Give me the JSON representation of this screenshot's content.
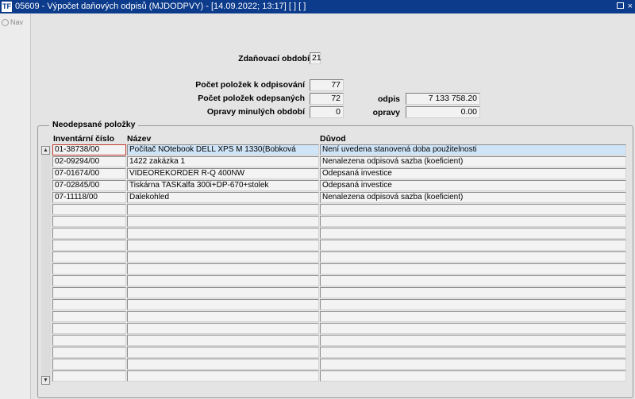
{
  "window": {
    "title": "05609 - Výpočet daňových odpisů (MJDODPVY) - [14.09.2022; 13:17] [ ] [ ]",
    "app_icon": "TF",
    "restore_glyph": "",
    "close_glyph": "×"
  },
  "nav": {
    "label": "Nav"
  },
  "form": {
    "period_label": "Zdaňovací období",
    "period_value": "21",
    "items_to_depreciate_label": "Počet položek k odpisování",
    "items_to_depreciate_value": "77",
    "items_depreciated_label": "Počet položek odepsaných",
    "items_depreciated_value": "72",
    "depreciation_label": "odpis",
    "depreciation_value": "7 133 758.20",
    "prior_corrections_label": "Opravy minulých období",
    "prior_corrections_value": "0",
    "corrections_label": "opravy",
    "corrections_value": "0.00"
  },
  "group": {
    "title": "Neodepsané položky",
    "columns": [
      "Inventární číslo",
      "Název",
      "Důvod"
    ],
    "rows": [
      {
        "inv": "01-38738/00",
        "name": "Počítač NOtebook DELL XPS M 1330(Bobková",
        "reason": "Není uvedena stanovená doba použitelnosti"
      },
      {
        "inv": "02-09294/00",
        "name": "1422 zakázka 1",
        "reason": "Nenalezena odpisová sazba (koeficient)"
      },
      {
        "inv": "07-01674/00",
        "name": "VIDEOREKORDER R-Q 400NW",
        "reason": "Odepsaná investice"
      },
      {
        "inv": "07-02845/00",
        "name": "Tiskárna TASKalfa 300i+DP-670+stolek",
        "reason": "Odepsaná investice"
      },
      {
        "inv": "07-11118/00",
        "name": "Dalekohled",
        "reason": "Nenalezena odpisová sazba (koeficient)"
      }
    ],
    "empty_rows": 15
  },
  "icons": {
    "scroll_up": "chevron-up-icon",
    "scroll_down": "chevron-down-icon"
  }
}
